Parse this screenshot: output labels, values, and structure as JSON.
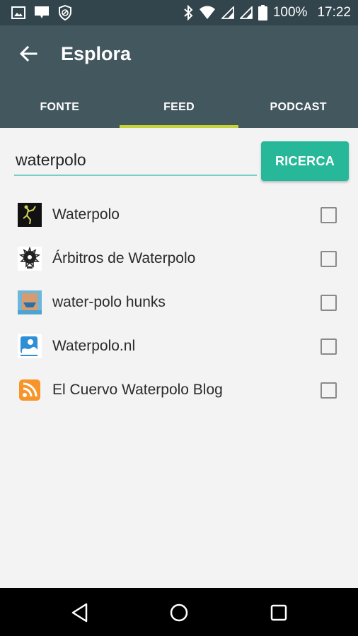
{
  "status_bar": {
    "battery": "100%",
    "time": "17:22"
  },
  "app_bar": {
    "title": "Esplora",
    "tabs": [
      {
        "label": "FONTE",
        "active": false
      },
      {
        "label": "FEED",
        "active": true
      },
      {
        "label": "PODCAST",
        "active": false
      }
    ]
  },
  "search": {
    "value": "waterpolo",
    "button_label": "RICERCA"
  },
  "results": [
    {
      "label": "Waterpolo",
      "icon": "waterpolo-feed-thumb",
      "checked": false
    },
    {
      "label": "Árbitros de Waterpolo",
      "icon": "arbitros-feed-thumb",
      "checked": false
    },
    {
      "label": "water-polo hunks",
      "icon": "hunks-feed-thumb",
      "checked": false
    },
    {
      "label": "Waterpolo.nl",
      "icon": "waterpolo-nl-thumb",
      "checked": false
    },
    {
      "label": "El Cuervo Waterpolo Blog",
      "icon": "rss-icon",
      "checked": false
    }
  ],
  "colors": {
    "status_bar": "#33454c",
    "app_bar": "#43575f",
    "tab_indicator": "#c7d33a",
    "accent": "#26b899",
    "input_underline": "#78cfc4",
    "rss": "#f7952b"
  }
}
